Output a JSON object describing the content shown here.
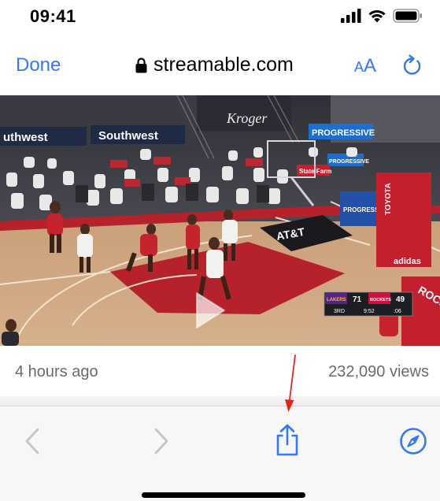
{
  "status_bar": {
    "time": "09:41"
  },
  "nav": {
    "done_label": "Done",
    "url": "streamable.com",
    "text_size_label_small": "A",
    "text_size_label_large": "A"
  },
  "video": {
    "overlay_text": {
      "banner_left": "uthwest",
      "banner_right": "Southwest",
      "kroger": "Kroger",
      "progressive_top": "PROGRESSIVE",
      "progressive_mid": "PROGRESSIVE",
      "progressive_side": "PROGRESSIVE",
      "state_farm": "State Farm",
      "att": "AT&T",
      "adidas": "adidas",
      "toyota": "TOYOTA",
      "rockets": "ROCKETS"
    },
    "scoreboard": {
      "team_left": "LAKERS",
      "score_left": "71",
      "team_right": "ROCKETS",
      "score_right": "49",
      "quarter": "3RD",
      "clock": "9:52",
      "shot_clock": ":06"
    }
  },
  "meta": {
    "posted": "4 hours ago",
    "views": "232,090 views"
  },
  "toolbar": {
    "back_icon": "chevron-left-icon",
    "forward_icon": "chevron-right-icon",
    "share_icon": "share-icon",
    "safari_icon": "compass-icon"
  },
  "colors": {
    "accent": "#3478f6",
    "annotation": "#e8231e",
    "court_paint": "#b5222c"
  }
}
